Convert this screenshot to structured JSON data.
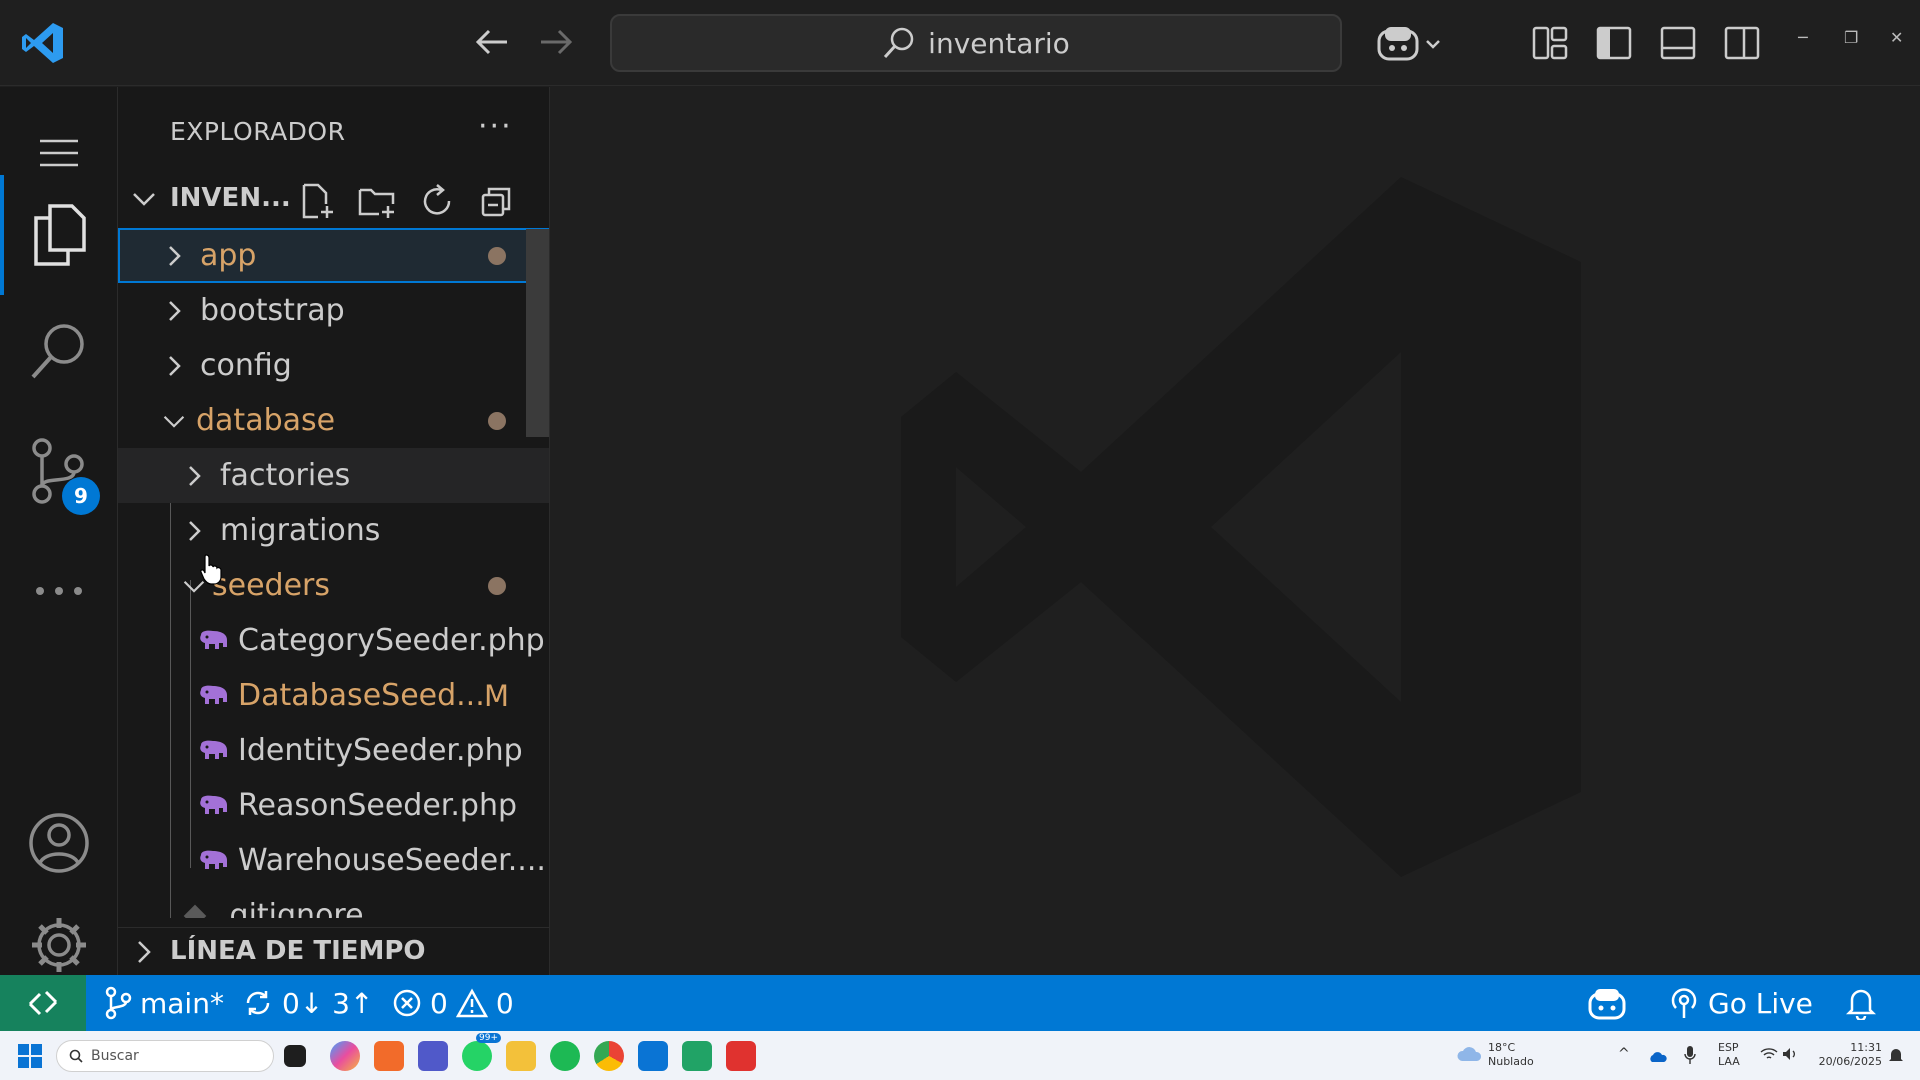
{
  "titlebar": {
    "search_text": "inventario"
  },
  "activity": {
    "scm_badge": "9"
  },
  "explorer": {
    "title": "EXPLORADOR",
    "more": "···",
    "workspace_name": "INVEN...",
    "items": [
      {
        "label": "app",
        "type": "folder",
        "state": "collapsed",
        "level": 0,
        "color": "#d7a368",
        "marker": "dot"
      },
      {
        "label": "bootstrap",
        "type": "folder",
        "state": "collapsed",
        "level": 0,
        "color": "#cccccc"
      },
      {
        "label": "config",
        "type": "folder",
        "state": "collapsed",
        "level": 0,
        "color": "#cccccc"
      },
      {
        "label": "database",
        "type": "folder",
        "state": "expanded",
        "level": 0,
        "color": "#d7a368",
        "marker": "dot"
      },
      {
        "label": "factories",
        "type": "folder",
        "state": "collapsed",
        "level": 1,
        "color": "#cccccc"
      },
      {
        "label": "migrations",
        "type": "folder",
        "state": "collapsed",
        "level": 1,
        "color": "#cccccc"
      },
      {
        "label": "seeders",
        "type": "folder",
        "state": "expanded",
        "level": 1,
        "color": "#d7a368",
        "marker": "dot"
      },
      {
        "label": "CategorySeeder.php",
        "type": "php",
        "level": 2,
        "color": "#cccccc"
      },
      {
        "label": "DatabaseSeed...",
        "type": "php",
        "level": 2,
        "color": "#d7a368",
        "marker": "M"
      },
      {
        "label": "IdentitySeeder.php",
        "type": "php",
        "level": 2,
        "color": "#cccccc"
      },
      {
        "label": "ReasonSeeder.php",
        "type": "php",
        "level": 2,
        "color": "#cccccc"
      },
      {
        "label": "WarehouseSeeder....",
        "type": "php",
        "level": 2,
        "color": "#cccccc"
      },
      {
        "label": ".gitignore",
        "type": "git",
        "level": 1,
        "color": "#cccccc"
      }
    ],
    "timeline_label": "LÍNEA DE TIEMPO"
  },
  "statusbar": {
    "branch": "main*",
    "sync": "0↓ 3↑",
    "errors": "0",
    "warnings": "0",
    "golive": "Go Live"
  },
  "taskbar": {
    "search_placeholder": "Buscar",
    "whatsapp_badge": "99+",
    "weather_temp": "18°C",
    "weather_desc": "Nublado",
    "lang": "ESP",
    "lang2": "LAA",
    "time": "11:31",
    "date": "20/06/2025"
  },
  "colors": {
    "accent": "#0078d4",
    "modified": "#d7a368",
    "remote": "#16825d",
    "php": "#a371d7"
  }
}
